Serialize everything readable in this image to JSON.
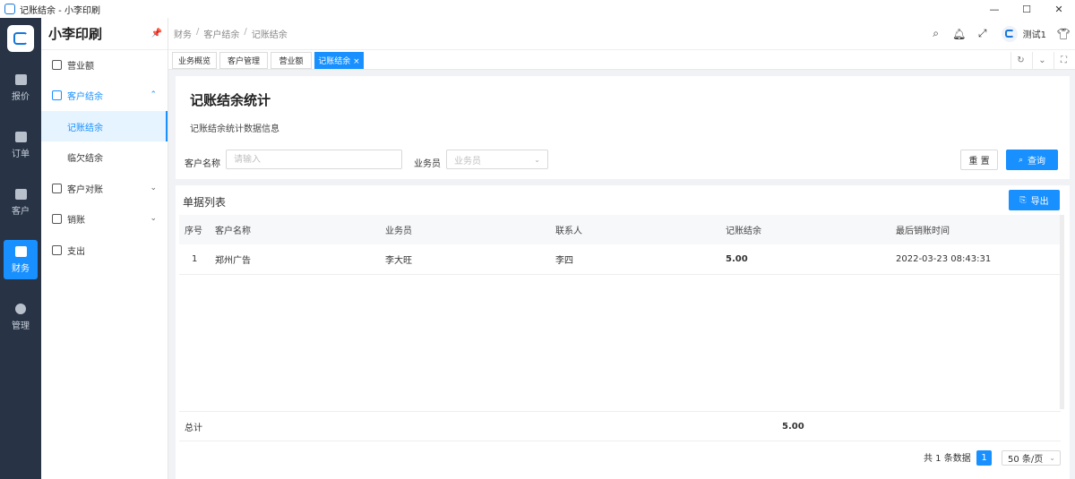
{
  "window": {
    "title": "记账结余 - 小李印刷",
    "controls": [
      "—",
      "☐",
      "✕"
    ]
  },
  "rail": {
    "items": [
      {
        "label": "报价",
        "icon": "calendar-icon"
      },
      {
        "label": "订单",
        "icon": "clipboard-icon"
      },
      {
        "label": "客户",
        "icon": "contact-icon"
      },
      {
        "label": "财务",
        "icon": "wallet-icon"
      },
      {
        "label": "管理",
        "icon": "gear-icon"
      }
    ],
    "active": "财务"
  },
  "sidebar": {
    "brand": "小李印刷",
    "pin_icon": "pin-icon",
    "items": [
      {
        "label": "营业额",
        "icon": "chart-icon"
      },
      {
        "label": "客户结余",
        "icon": "document-icon",
        "arrow": "⌃"
      },
      {
        "label": "记账结余"
      },
      {
        "label": "临欠结余"
      },
      {
        "label": "客户对账",
        "icon": "list-icon",
        "arrow": "⌄"
      },
      {
        "label": "销账",
        "icon": "ledger-icon",
        "arrow": "⌄"
      },
      {
        "label": "支出",
        "icon": "export-icon"
      }
    ]
  },
  "header": {
    "breadcrumb": [
      "财务",
      "客户结余",
      "记账结余"
    ],
    "user_name": "测试1",
    "tools": [
      "search-icon",
      "bell-icon",
      "fullscreen-icon",
      "shirt-icon"
    ]
  },
  "tabs": {
    "items": [
      "业务概览",
      "客户管理",
      "营业额",
      "记账结余 ×"
    ],
    "active": 3
  },
  "page": {
    "title": "记账结余统计",
    "subtitle": "记账结余统计数据信息"
  },
  "filters": {
    "customer_label": "客户名称",
    "customer_placeholder": "请输入",
    "salesman_label": "业务员",
    "salesman_placeholder": "业务员",
    "reset_label": "重 置",
    "search_label": "查询"
  },
  "list": {
    "title": "单据列表",
    "export_label": "导出",
    "columns": [
      "序号",
      "客户名称",
      "业务员",
      "联系人",
      "记账结余",
      "最后销账时间"
    ],
    "rows": [
      [
        "1",
        "郑州广告",
        "李大旺",
        "李四",
        "5.00",
        "2022-03-23 08:43:31"
      ]
    ],
    "total_label": "总计",
    "total_value": "5.00"
  },
  "pagination": {
    "summary": "共 1 条数据",
    "current_page": "1",
    "page_size": "50 条/页"
  },
  "colors": {
    "accent": "#1890ff",
    "rail_bg": "#283446",
    "page_bg": "#f0f2f5"
  }
}
